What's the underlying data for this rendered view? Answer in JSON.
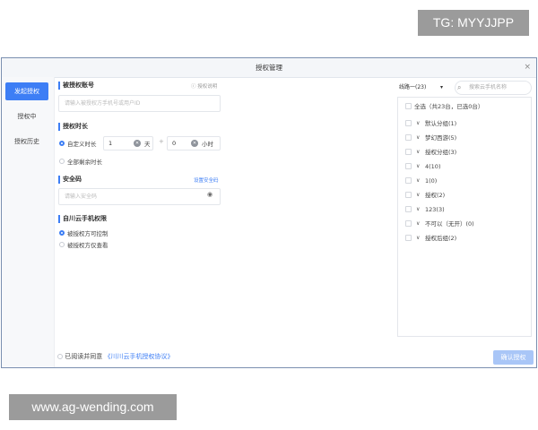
{
  "watermarks": {
    "top": "TG: MYYJJPP",
    "bottom": "www.ag-wending.com"
  },
  "dialog": {
    "title": "授权管理",
    "close": "×"
  },
  "sidebar": {
    "items": [
      {
        "label": "发起授权"
      },
      {
        "label": "授权中"
      },
      {
        "label": "授权历史"
      }
    ]
  },
  "account": {
    "title": "被授权账号",
    "help": "授权说明",
    "placeholder": "请输入被授权方手机号或用户ID"
  },
  "duration": {
    "title": "授权时长",
    "custom_label": "自定义时长",
    "days_value": "1",
    "days_unit": "天",
    "plus": "+",
    "hours_value": "0",
    "hours_unit": "小时",
    "remaining_label": "全部剩余时长"
  },
  "security": {
    "title": "安全码",
    "link": "设置安全码",
    "placeholder": "请输入安全码"
  },
  "permissions": {
    "title": "自川云手机权限",
    "opt1": "被授权方可控制",
    "opt2": "被授权方仅查看"
  },
  "right": {
    "line_select": "线路一(23)",
    "search_placeholder": "搜索云手机名称",
    "select_all": "全选（共23台，已选0台）",
    "groups": [
      {
        "name": "默认分组(1)"
      },
      {
        "name": "梦幻西游(5)"
      },
      {
        "name": "授权分组(3)"
      },
      {
        "name": "4(10)"
      },
      {
        "name": "1(0)"
      },
      {
        "name": "授权(2)"
      },
      {
        "name": "123(3)"
      },
      {
        "name": "不可以（无开）(0)"
      },
      {
        "name": "授权后组(2)"
      }
    ]
  },
  "footer": {
    "agree_text": "已阅读并同意",
    "agreement_link": "《川川云手机授权协议》",
    "confirm": "确认授权"
  }
}
